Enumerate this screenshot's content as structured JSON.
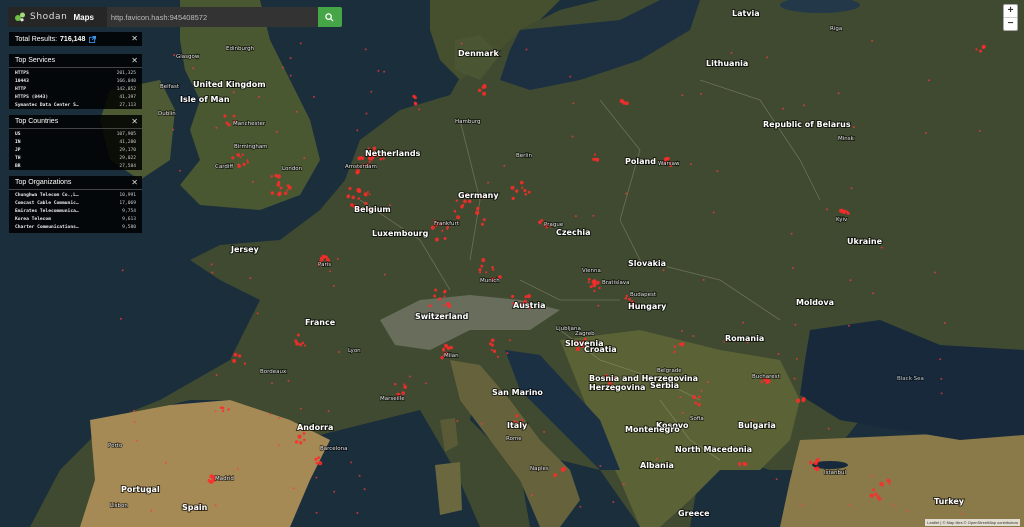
{
  "header": {
    "brand": "Shodan",
    "nav_label": "Maps",
    "search_value": "http.favicon.hash:945408572",
    "search_icon": "search-icon"
  },
  "total": {
    "label": "Total Results:",
    "value": "716,148"
  },
  "panels": {
    "services": {
      "title": "Top Services",
      "rows": [
        {
          "name": "HTTPS",
          "count": "201,325"
        },
        {
          "name": "10443",
          "count": "166,040"
        },
        {
          "name": "HTTP",
          "count": "142,852"
        },
        {
          "name": "HTTPS (8443)",
          "count": "41,397"
        },
        {
          "name": "Symantec Data Center S…",
          "count": "27,113"
        }
      ]
    },
    "countries": {
      "title": "Top Countries",
      "rows": [
        {
          "name": "US",
          "count": "107,905"
        },
        {
          "name": "IN",
          "count": "41,280"
        },
        {
          "name": "JP",
          "count": "29,170"
        },
        {
          "name": "TH",
          "count": "29,022"
        },
        {
          "name": "BR",
          "count": "27,584"
        }
      ]
    },
    "organizations": {
      "title": "Top Organizations",
      "rows": [
        {
          "name": "Chunghwa Telecom Co.,L…",
          "count": "10,991"
        },
        {
          "name": "Comcast Cable Communic…",
          "count": "17,069"
        },
        {
          "name": "Emirates Telecommunica…",
          "count": "9,754"
        },
        {
          "name": "Korea Telecom",
          "count": "9,613"
        },
        {
          "name": "Charter Communications…",
          "count": "9,580"
        }
      ]
    }
  },
  "zoom": {
    "in": "+",
    "out": "−"
  },
  "attribution": "Leaflet | © Map tiles © OpenStreetMap contributors",
  "map_labels": {
    "countries": [
      "Latvia",
      "Denmark",
      "Lithuania",
      "United Kingdom",
      "Isle of Man",
      "Republic of Belarus",
      "Netherlands",
      "Poland",
      "Germany",
      "Belgium",
      "Luxembourg",
      "Czechia",
      "Ukraine",
      "Jersey",
      "Slovakia",
      "France",
      "Moldova",
      "Austria",
      "Switzerland",
      "Hungary",
      "Slovenia",
      "Croatia",
      "Romania",
      "Bosnia and Herzegovina",
      "Serbia",
      "San Marino",
      "Andorra",
      "Italy",
      "Kosovo",
      "Bulgaria",
      "Montenegro",
      "North Macedonia",
      "Spain",
      "Portugal",
      "Albania",
      "Greece",
      "Turkey"
    ],
    "cities": [
      "Riga",
      "Glasgow",
      "Edinburgh",
      "Belfast",
      "Dublin",
      "Manchester",
      "Birmingham",
      "London",
      "Cardiff",
      "Hamburg",
      "Amsterdam",
      "Berlin",
      "Warsaw",
      "Minsk",
      "Kyiv",
      "Prague",
      "Frankfurt",
      "Munich",
      "Vienna",
      "Bratislava",
      "Budapest",
      "Paris",
      "Lyon",
      "Milan",
      "Zagreb",
      "Belgrade",
      "Bucharest",
      "Sofia",
      "Rome",
      "Barcelona",
      "Madrid",
      "Lisbon",
      "Istanbul",
      "Porto",
      "Marseille",
      "Bordeaux",
      "Naples",
      "Ljubljana"
    ],
    "seas": [
      "Black Sea"
    ]
  }
}
